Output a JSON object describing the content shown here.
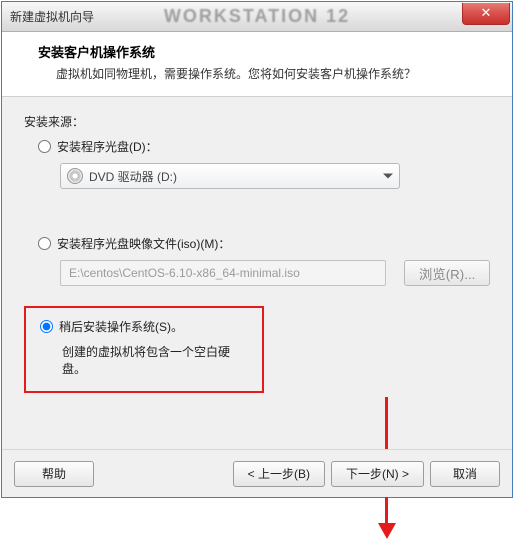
{
  "window": {
    "title": "新建虚拟机向导",
    "background_text": "WORKSTATION 12",
    "close_glyph": "✕"
  },
  "header": {
    "heading": "安装客户机操作系统",
    "subheading": "虚拟机如同物理机，需要操作系统。您将如何安装客户机操作系统？"
  },
  "source": {
    "label": "安装来源：",
    "options": {
      "disc": {
        "label": "安装程序光盘(D)：",
        "dropdown_value": "DVD 驱动器 (D:)"
      },
      "iso": {
        "label": "安装程序光盘映像文件(iso)(M)：",
        "path_value": "E:\\centos\\CentOS-6.10-x86_64-minimal.iso",
        "browse_label": "浏览(R)..."
      },
      "later": {
        "label": "稍后安装操作系统(S)。",
        "description": "创建的虚拟机将包含一个空白硬盘。",
        "selected": true
      }
    }
  },
  "footer": {
    "help": "帮助",
    "back": "< 上一步(B)",
    "next": "下一步(N) >",
    "cancel": "取消"
  },
  "colors": {
    "highlight_border": "#e31b1b",
    "annotation_arrow": "#e31b1b"
  }
}
